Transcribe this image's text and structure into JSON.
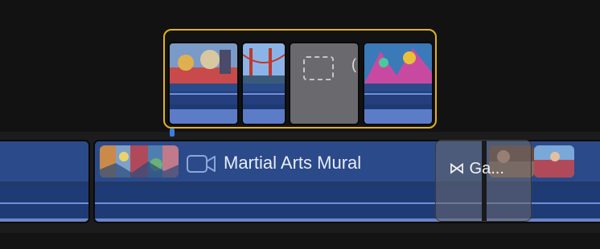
{
  "timeline": {
    "primary_clip_title": "Martial Arts Mural",
    "transition_label": "⋈ Ga...",
    "gap_cut_letter": "("
  },
  "colors": {
    "selection_outline": "#e3b21b",
    "clip_blue": "#2a4a8a",
    "gap_gray": "#6a6a6e",
    "connection_blue": "#3a7de0"
  },
  "icons": {
    "camera": "video-camera-icon",
    "gap": "placeholder-icon",
    "transition": "cross-dissolve-icon"
  }
}
